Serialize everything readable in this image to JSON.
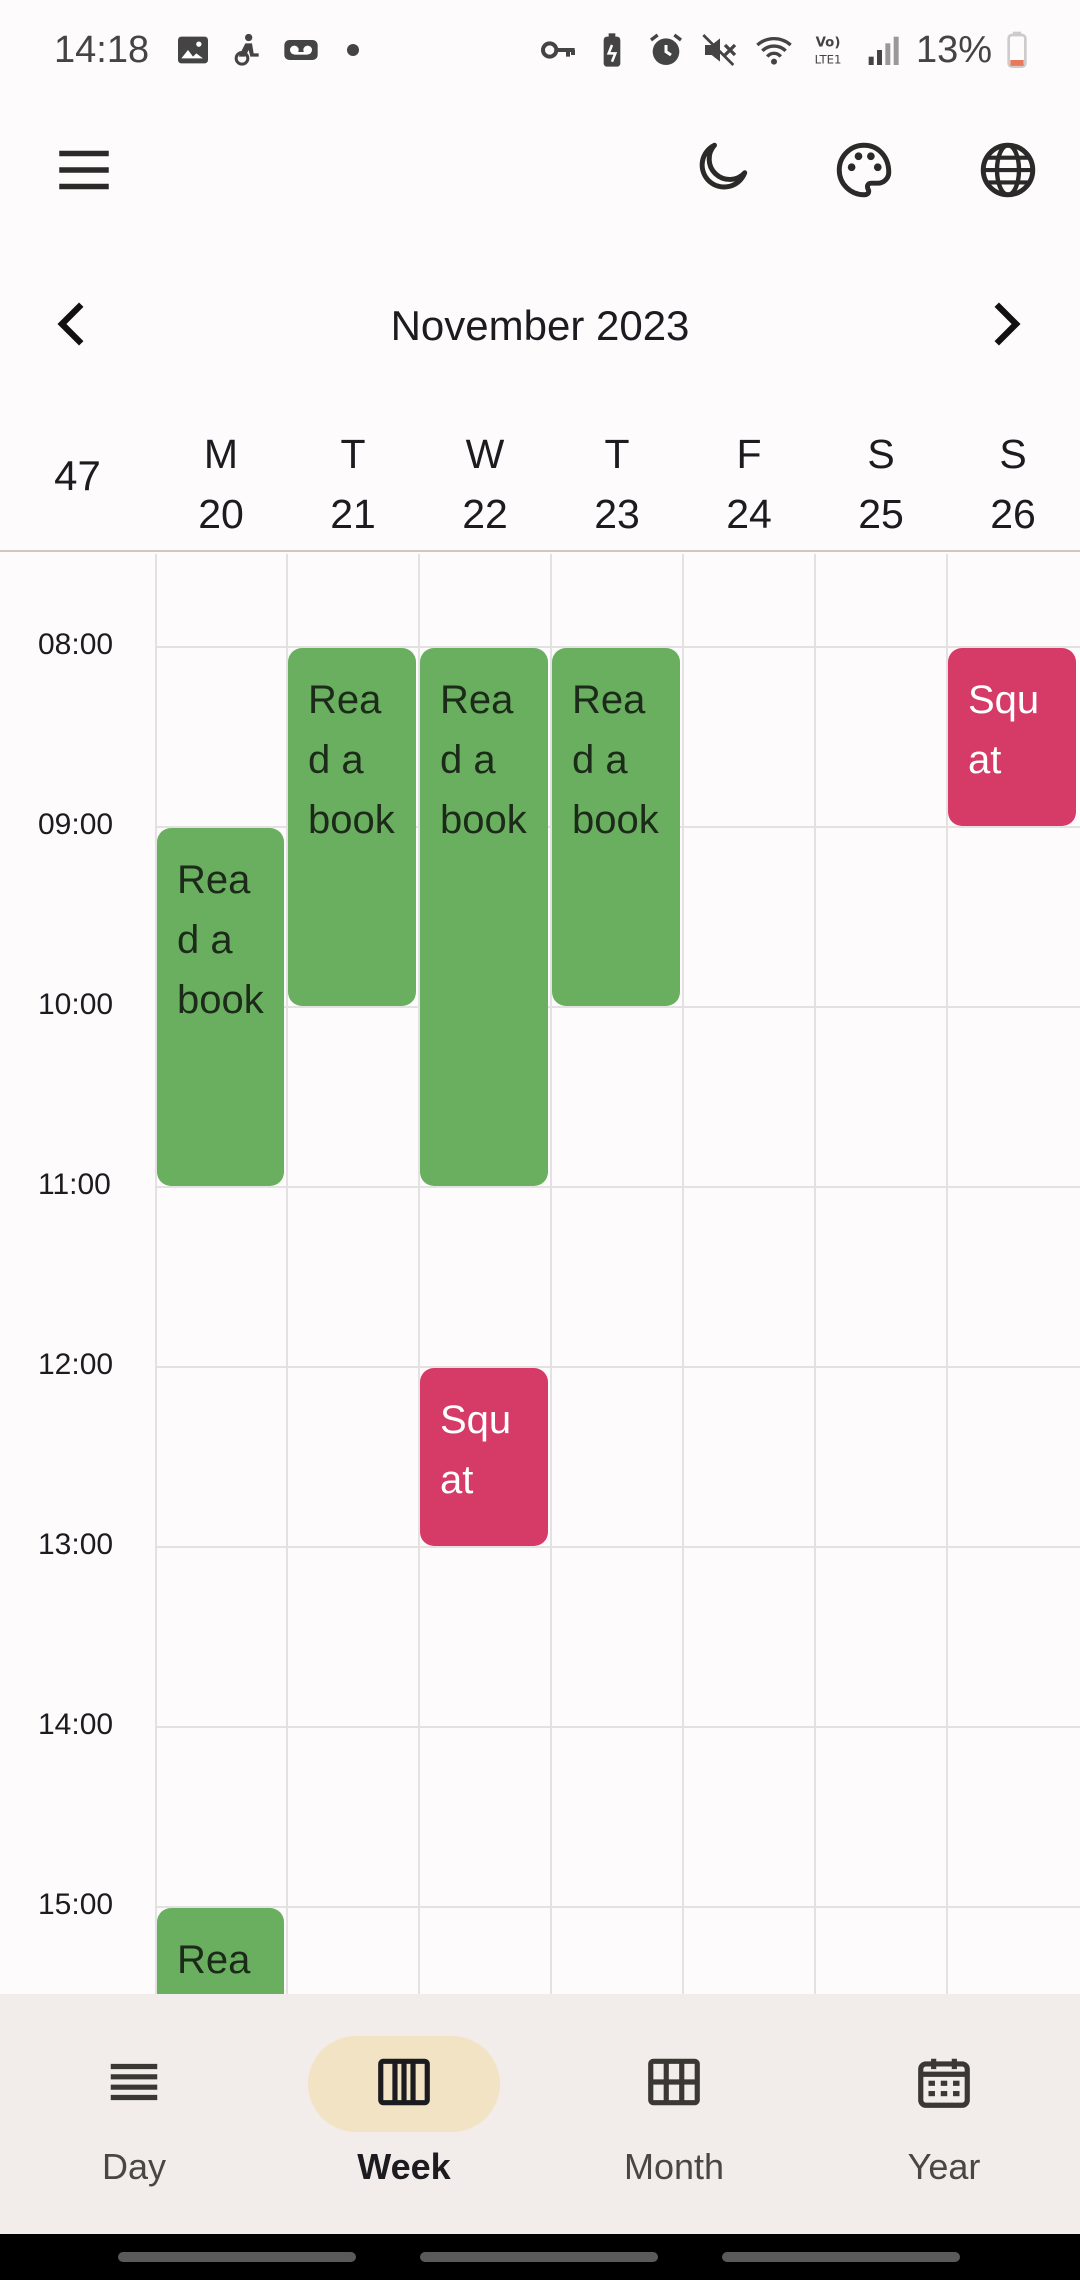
{
  "status_bar": {
    "time": "14:18",
    "battery": "13%",
    "left_icons": [
      "image-icon",
      "accessibility-icon",
      "voicemail-icon"
    ],
    "right_icons": [
      "vpn-key-icon",
      "battery-saver-icon",
      "alarm-icon",
      "mute-icon",
      "wifi-icon",
      "volte-icon",
      "signal-icon",
      "battery-icon"
    ]
  },
  "app_bar": {
    "icons": [
      "menu-icon",
      "moon-icon",
      "palette-icon",
      "globe-icon"
    ]
  },
  "calendar": {
    "month_title": "November 2023",
    "week_number": "47",
    "days": [
      {
        "letter": "M",
        "date": "20"
      },
      {
        "letter": "T",
        "date": "21"
      },
      {
        "letter": "W",
        "date": "22"
      },
      {
        "letter": "T",
        "date": "23"
      },
      {
        "letter": "F",
        "date": "24"
      },
      {
        "letter": "S",
        "date": "25"
      },
      {
        "letter": "S",
        "date": "26"
      }
    ],
    "hours": [
      "08:00",
      "09:00",
      "10:00",
      "11:00",
      "12:00",
      "13:00",
      "14:00",
      "15:00"
    ],
    "events": [
      {
        "title": "Read a book",
        "day_index": 0,
        "start": "09:00",
        "end": "11:00",
        "kind": "book"
      },
      {
        "title": "Read a book",
        "day_index": 1,
        "start": "08:00",
        "end": "10:00",
        "kind": "book"
      },
      {
        "title": "Read a book",
        "day_index": 2,
        "start": "08:00",
        "end": "11:00",
        "kind": "book"
      },
      {
        "title": "Read a book",
        "day_index": 3,
        "start": "08:00",
        "end": "10:00",
        "kind": "book"
      },
      {
        "title": "Squat",
        "day_index": 6,
        "start": "08:00",
        "end": "09:00",
        "kind": "squat"
      },
      {
        "title": "Squat",
        "day_index": 2,
        "start": "12:00",
        "end": "13:00",
        "kind": "squat"
      },
      {
        "title": "Rea",
        "day_index": 0,
        "start": "15:00",
        "end": "16:00",
        "kind": "book"
      }
    ],
    "colors": {
      "book": "#6aaf5f",
      "squat": "#d63a67"
    }
  },
  "bottom_nav": {
    "items": [
      {
        "label": "Day",
        "icon": "day-view-icon",
        "active": false
      },
      {
        "label": "Week",
        "icon": "week-view-icon",
        "active": true
      },
      {
        "label": "Month",
        "icon": "month-view-icon",
        "active": false
      },
      {
        "label": "Year",
        "icon": "year-view-icon",
        "active": false
      }
    ],
    "active_color": "#f2e3c4"
  }
}
